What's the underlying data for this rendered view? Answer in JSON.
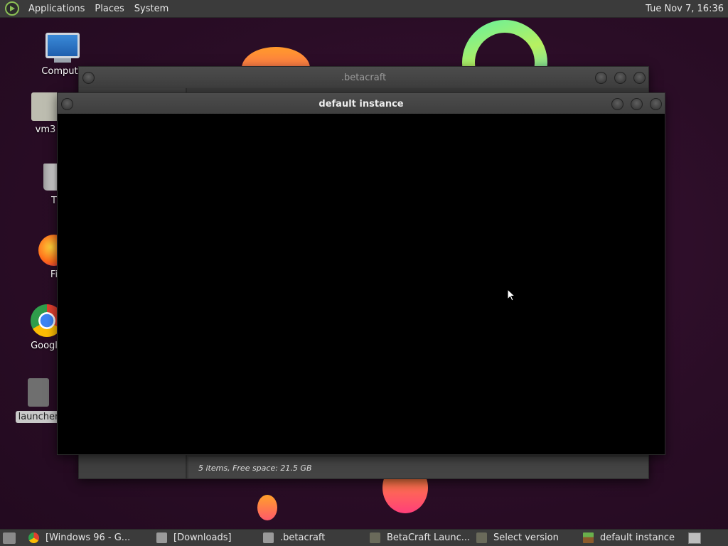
{
  "top_panel": {
    "menus": [
      "Applications",
      "Places",
      "System"
    ],
    "clock": "Tue Nov 7, 16:36"
  },
  "desktop": {
    "icons": [
      {
        "label": "Compute",
        "icon": "computer-icon"
      },
      {
        "label": "vm3",
        "icon": "drive-icon"
      },
      {
        "label": "T",
        "icon": "trash-icon"
      },
      {
        "label": "Fi",
        "icon": "firefox-icon"
      },
      {
        "label": "Google",
        "icon": "chrome-icon"
      },
      {
        "label": "launcher",
        "icon": "file-icon"
      }
    ]
  },
  "windows": {
    "back": {
      "title": ".betacraft",
      "status": "5 items, Free space: 21.5 GB"
    },
    "front": {
      "title": "default instance"
    }
  },
  "taskbar": {
    "tasks": [
      {
        "label": "[Windows 96 - G...",
        "icon": "chrome-icon"
      },
      {
        "label": "[Downloads]",
        "icon": "folder-icon"
      },
      {
        "label": ".betacraft",
        "icon": "folder-icon"
      },
      {
        "label": "BetaCraft Launc...",
        "icon": "java-icon"
      },
      {
        "label": "Select version",
        "icon": "java-icon"
      },
      {
        "label": "default instance",
        "icon": "grass-block-icon"
      }
    ]
  },
  "colors": {
    "panel": "#3b3b3b",
    "wallpaper": "#2a0e26",
    "window": "#404040"
  }
}
